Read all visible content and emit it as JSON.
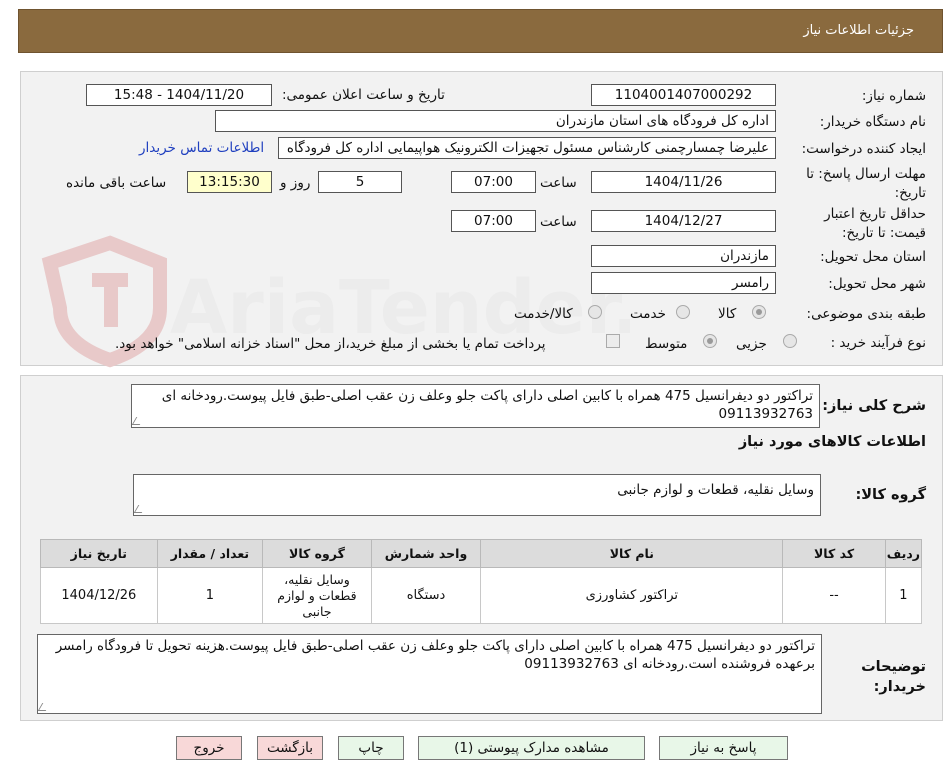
{
  "header": {
    "title": "جزئیات اطلاعات نیاز"
  },
  "form": {
    "need_number_label": "شماره نیاز:",
    "need_number": "1104001407000292",
    "announce_label": "تاریخ و ساعت اعلان عمومی:",
    "announce_value": "1404/11/20 - 15:48",
    "buyer_org_label": "نام دستگاه خریدار:",
    "buyer_org": "اداره کل فرودگاه های استان مازندران",
    "requester_label": "ایجاد کننده درخواست:",
    "requester": "علیرضا چمسارچمنی کارشناس مسئول تجهیزات الکترونیک هواپیمایی اداره کل فرودگاه",
    "contact_link": "اطلاعات تماس خریدار",
    "deadline_label": "مهلت ارسال پاسخ: تا تاریخ:",
    "deadline_date": "1404/11/26",
    "time_word": "ساعت",
    "deadline_time": "07:00",
    "days_value": "5",
    "days_word": "روز و",
    "remaining_time": "13:15:30",
    "remaining_word": "ساعت باقی مانده",
    "min_valid_label": "حداقل تاریخ اعتبار قیمت: تا تاریخ:",
    "min_valid_date": "1404/12/27",
    "min_valid_time": "07:00",
    "province_label": "استان محل تحویل:",
    "province": "مازندران",
    "city_label": "شهر محل تحویل:",
    "city": "رامسر",
    "category_label": "طبقه بندی موضوعی:",
    "category_options": [
      "کالا",
      "خدمت",
      "کالا/خدمت"
    ],
    "category_selected": "کالا",
    "process_label": "نوع فرآیند خرید :",
    "process_options": [
      "جزیی",
      "متوسط"
    ],
    "process_selected": "متوسط",
    "payment_note": "پرداخت تمام یا بخشی از مبلغ خرید،از محل \"اسناد خزانه اسلامی\" خواهد بود."
  },
  "summary": {
    "label": "شرح کلی نیاز:",
    "text": "تراکتور دو دیفرانسیل 475 همراه با کابین اصلی دارای پاکت جلو وعلف زن عقب اصلی-طبق فایل پیوست.رودخانه ای 09113932763"
  },
  "goods_section": {
    "title": "اطلاعات کالاهای مورد نیاز",
    "group_label": "گروه کالا:",
    "group_value": "وسایل نقلیه، قطعات و لوازم جانبی"
  },
  "table": {
    "headers": [
      "ردیف",
      "کد کالا",
      "نام کالا",
      "واحد شمارش",
      "گروه کالا",
      "تعداد / مقدار",
      "تاریخ نیاز"
    ],
    "rows": [
      [
        "1",
        "--",
        "تراکتور کشاورزی",
        "دستگاه",
        "وسایل نقلیه، قطعات و لوازم جانبی",
        "1",
        "1404/12/26"
      ]
    ]
  },
  "buyer_notes": {
    "label": "توضیحات خریدار:",
    "text": "تراکتور دو دیفرانسیل 475 همراه با کابین اصلی دارای پاکت جلو وعلف زن عقب اصلی-طبق فایل پیوست.هزینه تحویل تا فرودگاه رامسر برعهده فروشنده است.رودخانه ای 09113932763"
  },
  "buttons": {
    "reply": "پاسخ به نیاز",
    "view_docs": "مشاهده مدارک پیوستی (1)",
    "print": "چاپ",
    "back": "بازگشت",
    "exit": "خروج"
  },
  "watermark": {
    "text": "AriaTender.net"
  },
  "colors": {
    "header": "#8a6a3e",
    "panel": "#f2f2f2",
    "highlight": "#ffffcc",
    "link": "#1f3fbf"
  }
}
